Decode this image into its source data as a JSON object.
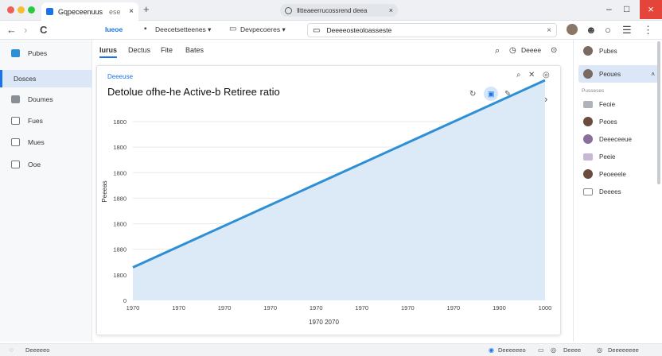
{
  "browser": {
    "tab_title": "Gqpeceenuus",
    "tab_sub": "ese",
    "tab_close": "×",
    "new_tab": "+",
    "address_text": "Ⅱtteaeerrucossrend deea",
    "address_close": "×",
    "window_controls": [
      "–",
      "□"
    ],
    "window_close": "×"
  },
  "toolbar": {
    "back": "←",
    "forward": "›",
    "reload": "C",
    "brand": "Iueoe",
    "bookmarks": "Deecetsetteenes ▾",
    "workspace": "Devpecoeres ▾",
    "search_text": "Deeeeosteoloasseste",
    "search_clear": "×"
  },
  "sidebar": {
    "items": [
      {
        "label": "Pubes"
      },
      {
        "label": "Dosces"
      },
      {
        "label": "Doumes"
      },
      {
        "label": "Fues"
      },
      {
        "label": "Mues"
      },
      {
        "label": "Ooe"
      }
    ]
  },
  "subtabs": {
    "items": [
      "Iurus",
      "Dectus",
      "Fite",
      "Bates"
    ],
    "search_text": "Deeee"
  },
  "card": {
    "breadcrumb": "Deeeuse",
    "title": "Detolue ofhe-he Active-b Retiree ratio"
  },
  "chart_data": {
    "type": "area",
    "title": "Detolue ofhe-he Active-b Retiree ratio",
    "xlabel": "1970 2070",
    "ylabel": "Peeeas",
    "y_tick_labels": [
      "0",
      "1800",
      "1880",
      "1800",
      "1880",
      "1800",
      "1800",
      "1800"
    ],
    "x_tick_labels": [
      "1970",
      "1970",
      "1970",
      "1970",
      "1970",
      "1970",
      "1970",
      "1970",
      "1900",
      "1000"
    ],
    "x": [
      0,
      1
    ],
    "values": [
      0.15,
      1.0
    ],
    "ylim": [
      0,
      1
    ],
    "grid": true,
    "line_color": "#2f8fd6",
    "fill_color": "#dce9f6"
  },
  "right_panel": {
    "header": "Pubes",
    "active_item": "Peoues",
    "section": "Pusseses",
    "items": [
      {
        "label": "Feoie",
        "icon": "folder"
      },
      {
        "label": "Peoes",
        "icon": "avatar"
      },
      {
        "label": "Deeeceeue",
        "icon": "avatar"
      },
      {
        "label": "Peeie",
        "icon": "folder"
      },
      {
        "label": "Peoeeele",
        "icon": "avatar"
      },
      {
        "label": "Deeees",
        "icon": "folder"
      }
    ]
  },
  "status": {
    "left": "Deeeeeo",
    "center": "Deeeeeeo",
    "right1": "Deeee",
    "right2": "Deeeeeeee"
  }
}
